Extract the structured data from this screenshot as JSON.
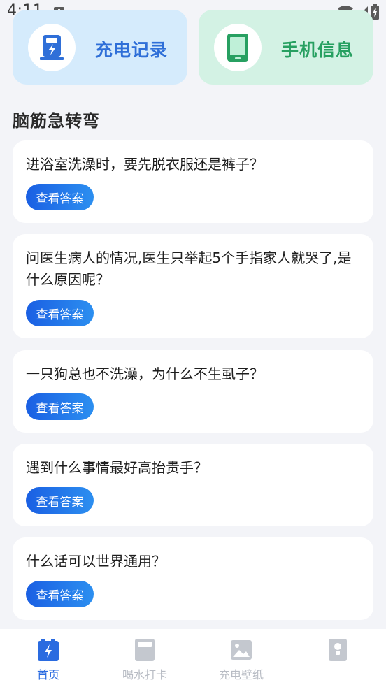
{
  "status_bar": {
    "time": "4:11",
    "notification_glyph": "A"
  },
  "top_cards": [
    {
      "title": "充电记录",
      "icon": "charging-station-icon",
      "color": "#2f6fd8"
    },
    {
      "title": "手机信息",
      "icon": "phone-icon",
      "color": "#27a061"
    }
  ],
  "section_title": "脑筋急转弯",
  "riddles": [
    {
      "question": "进浴室洗澡时，要先脱衣服还是裤子？",
      "button": "查看答案"
    },
    {
      "question": "问医生病人的情况,医生只举起5个手指家人就哭了,是什么原因呢？",
      "button": "查看答案"
    },
    {
      "question": "一只狗总也不洗澡，为什么不生虱子？",
      "button": "查看答案"
    },
    {
      "question": "遇到什么事情最好高抬贵手？",
      "button": "查看答案"
    },
    {
      "question": "什么话可以世界通用？",
      "button": "查看答案"
    }
  ],
  "bottom_nav": [
    {
      "label": "首页",
      "icon": "home-battery-icon",
      "active": true
    },
    {
      "label": "喝水打卡",
      "icon": "water-cup-icon",
      "active": false
    },
    {
      "label": "充电壁纸",
      "icon": "wallpaper-image-icon",
      "active": false
    },
    {
      "label": "",
      "icon": "idea-card-icon",
      "active": false
    }
  ],
  "colors": {
    "accent": "#2a6be0",
    "inactive": "#b8bcc4",
    "background": "#f3f4f8"
  }
}
